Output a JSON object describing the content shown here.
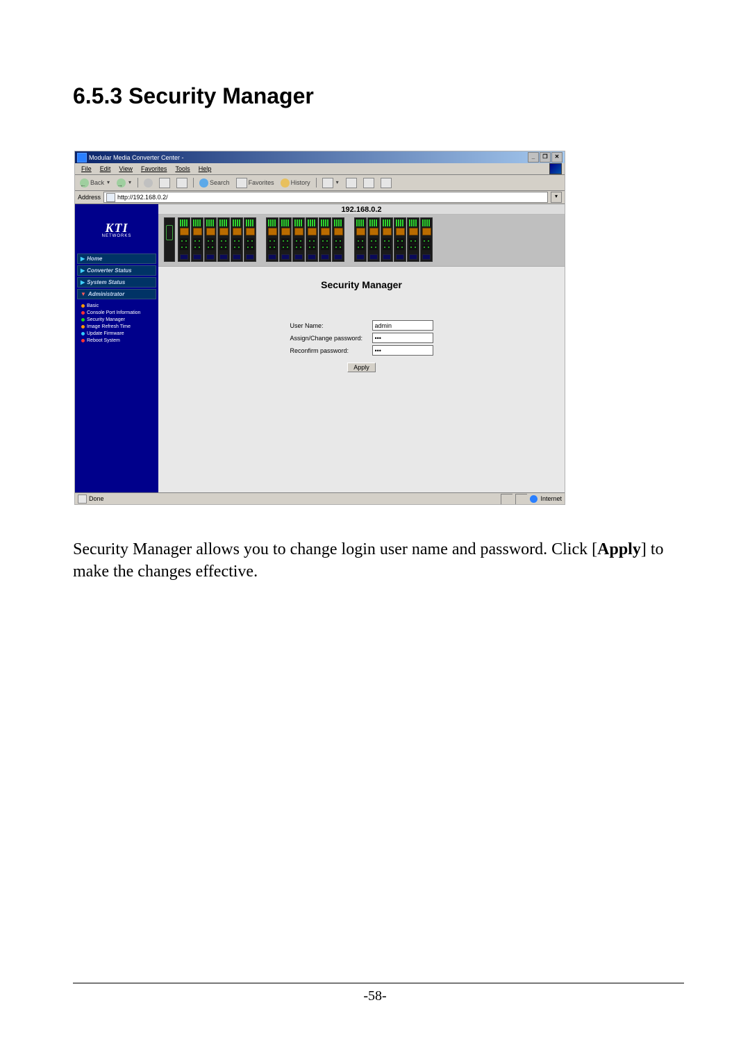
{
  "doc": {
    "heading": "6.5.3 Security Manager",
    "body_text_1": "Security Manager allows you to change login user name and password. Click [",
    "body_text_emph": "Apply",
    "body_text_2": "] to make the changes effective.",
    "page_number": "-58-"
  },
  "window": {
    "title": "Modular Media Converter Center -",
    "min": "_",
    "max": "❐",
    "close": "✕"
  },
  "menubar": {
    "file": "File",
    "edit": "Edit",
    "view": "View",
    "favorites": "Favorites",
    "tools": "Tools",
    "help": "Help"
  },
  "toolbar": {
    "back": "Back",
    "search": "Search",
    "favorites": "Favorites",
    "history": "History"
  },
  "addressbar": {
    "label": "Address",
    "url": "http://192.168.0.2/"
  },
  "sidebar": {
    "brand": "KTI",
    "brand_sub": "NETWORKS",
    "home": "Home",
    "converter_status": "Converter Status",
    "system_status": "System Status",
    "administrator": "Administrator",
    "subs": {
      "basic": "Basic",
      "console": "Console Port Information",
      "security": "Security Manager",
      "refresh": "Image Refresh Time",
      "firmware": "Update Firmware",
      "reboot": "Reboot System"
    }
  },
  "main": {
    "ip": "192.168.0.2",
    "form_title": "Security Manager",
    "username_label": "User Name:",
    "username_value": "admin",
    "password_label": "Assign/Change password:",
    "password_value": "•••",
    "reconfirm_label": "Reconfirm password:",
    "reconfirm_value": "•••",
    "apply": "Apply"
  },
  "status": {
    "done": "Done",
    "internet": "Internet"
  }
}
